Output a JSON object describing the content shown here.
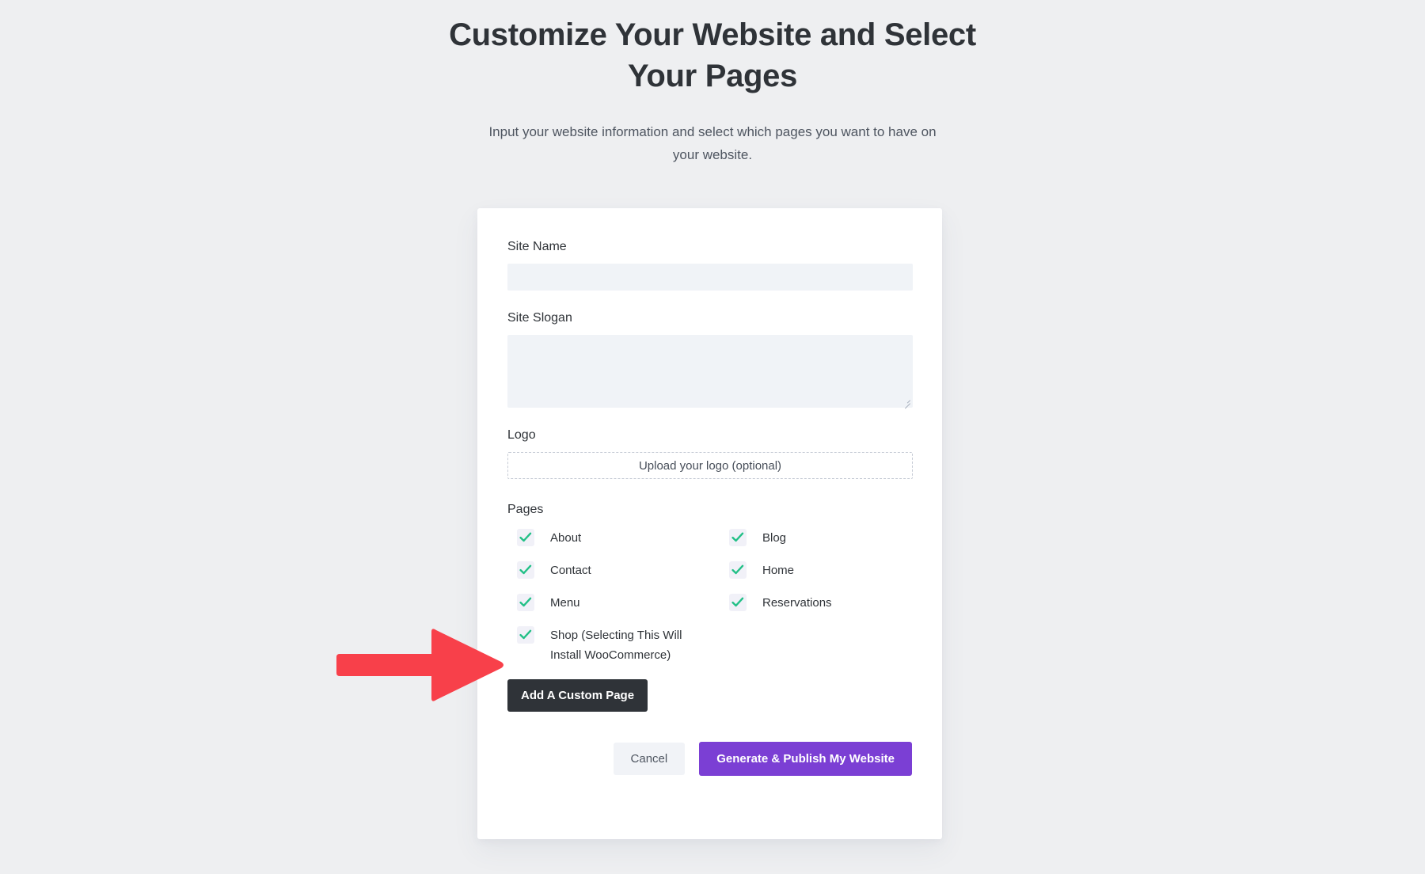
{
  "header": {
    "title": "Customize Your Website and Select Your Pages",
    "subtitle": "Input your website information and select which pages you want to have on your website."
  },
  "form": {
    "site_name": {
      "label": "Site Name",
      "value": "",
      "placeholder": ""
    },
    "site_slogan": {
      "label": "Site Slogan",
      "value": "",
      "placeholder": ""
    },
    "logo": {
      "label": "Logo",
      "upload_label": "Upload your logo (optional)"
    },
    "pages": {
      "label": "Pages",
      "options": [
        {
          "label": "About",
          "checked": true
        },
        {
          "label": "Blog",
          "checked": true
        },
        {
          "label": "Contact",
          "checked": true
        },
        {
          "label": "Home",
          "checked": true
        },
        {
          "label": "Menu",
          "checked": true
        },
        {
          "label": "Reservations",
          "checked": true
        },
        {
          "label": "Shop (Selecting This Will Install WooCommerce)",
          "checked": true
        }
      ]
    },
    "add_custom_page_label": "Add A Custom Page"
  },
  "actions": {
    "cancel_label": "Cancel",
    "publish_label": "Generate & Publish My Website"
  },
  "colors": {
    "page_background": "#eeeff1",
    "card_background": "#ffffff",
    "input_background": "#f0f3f7",
    "checkbox_background": "#f1f1f8",
    "check_green": "#23c087",
    "dark_button": "#2f3338",
    "purple_button": "#7b3fd4",
    "arrow_red": "#f8404a",
    "text_primary": "#2f3338",
    "text_secondary": "#4e5560"
  }
}
